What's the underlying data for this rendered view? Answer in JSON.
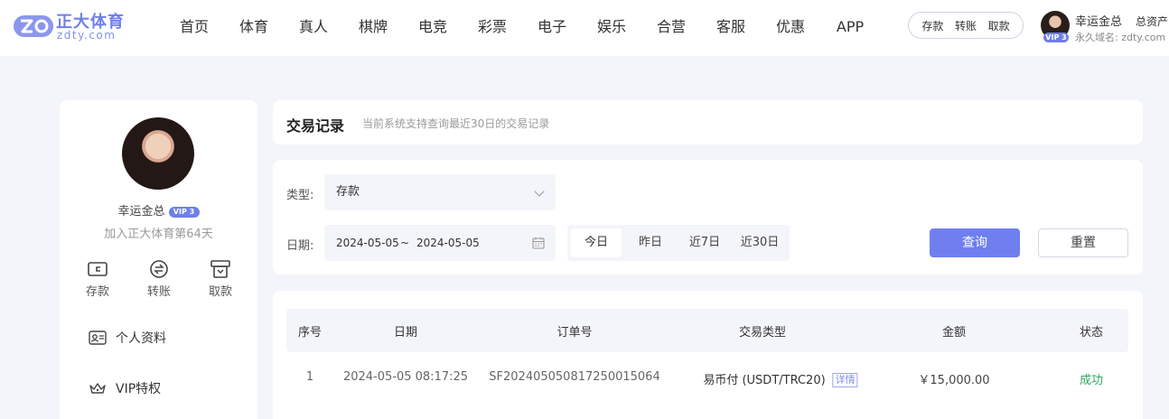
{
  "brand": {
    "mark": "ZD",
    "title": "正大体育",
    "subtitle": "zdty.com",
    "accent": "#6f7fe8"
  },
  "nav": {
    "items": [
      {
        "label": "首页"
      },
      {
        "label": "体育"
      },
      {
        "label": "真人"
      },
      {
        "label": "棋牌"
      },
      {
        "label": "电竞"
      },
      {
        "label": "彩票"
      },
      {
        "label": "电子"
      },
      {
        "label": "娱乐"
      },
      {
        "label": "合营"
      },
      {
        "label": "客服"
      },
      {
        "label": "优惠"
      },
      {
        "label": "APP"
      }
    ]
  },
  "quick_actions": {
    "deposit": "存款",
    "transfer": "转账",
    "withdraw": "取款"
  },
  "user": {
    "name": "幸运金总",
    "vip": "VIP 3",
    "assets_label": "总资产",
    "domain_label": "永久域名: zdty.com"
  },
  "sidebar": {
    "name": "幸运金总",
    "vip": "VIP 3",
    "join_text": "加入正大体育第64天",
    "actions": [
      {
        "label": "存款",
        "icon": "wallet-icon"
      },
      {
        "label": "转账",
        "icon": "transfer-icon"
      },
      {
        "label": "取款",
        "icon": "withdraw-icon"
      }
    ],
    "menu": [
      {
        "label": "个人资料",
        "icon": "id-card-icon"
      },
      {
        "label": "VIP特权",
        "icon": "crown-icon"
      }
    ]
  },
  "page": {
    "title": "交易记录",
    "subtitle": "当前系统支持查询最近30日的交易记录"
  },
  "filters": {
    "type_label": "类型:",
    "type_value": "存款",
    "date_label": "日期:",
    "date_start": "2024-05-05",
    "date_sep": "~",
    "date_end": "2024-05-05",
    "quick_dates": [
      "今日",
      "昨日",
      "近7日",
      "近30日"
    ],
    "quick_active": "今日",
    "query_button": "查询",
    "reset_button": "重置"
  },
  "table": {
    "headers": [
      "序号",
      "日期",
      "订单号",
      "交易类型",
      "金额",
      "状态"
    ],
    "rows": [
      {
        "index": "1",
        "date": "2024-05-05 08:17:25",
        "order_no": "SF2024050508172500150​64",
        "type": "易币付 (USDT/TRC20)",
        "detail": "详情",
        "amount": "￥15,000.00",
        "status": "成功"
      }
    ]
  },
  "colors": {
    "primary_button": "#6f7ff0",
    "success": "#2fa864",
    "page_bg": "#f4f5fa"
  }
}
